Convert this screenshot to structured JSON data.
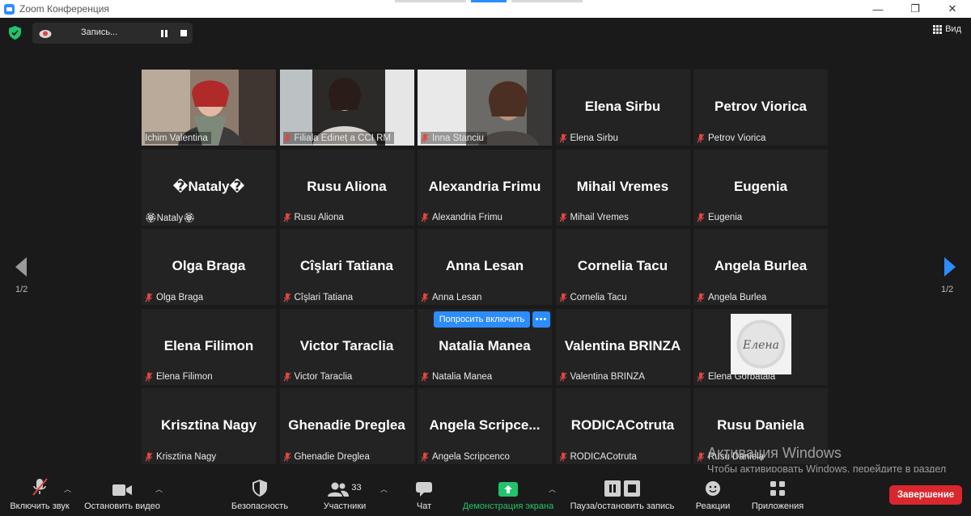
{
  "window": {
    "title": "Zoom Конференция",
    "minimize_glyph": "—",
    "maximize_glyph": "❐",
    "close_glyph": "✕"
  },
  "topbar": {
    "recording_label": "Запись...",
    "view_label": "Вид",
    "security_color": "#21c36b"
  },
  "gallery": {
    "page_indicator_left": "1/2",
    "page_indicator_right": "1/2",
    "ask_to_unmute_label": "Попросить включить",
    "more_label": "•••",
    "avatar_text": "Елена",
    "tiles": [
      {
        "name": "Ichim Valentina",
        "big": "",
        "muted": false,
        "type": "video",
        "active": true
      },
      {
        "name": "Filiala Edineț a CCI RM",
        "big": "",
        "muted": true,
        "type": "video"
      },
      {
        "name": "Inna Stanciu",
        "big": "",
        "muted": true,
        "type": "video"
      },
      {
        "name": "Elena Sirbu",
        "big": "Elena Sirbu",
        "muted": true
      },
      {
        "name": "Petrov Viorica",
        "big": "Petrov Viorica",
        "muted": true
      },
      {
        "name": "🏵Nataly🏵",
        "big": "�Nataly�",
        "muted": false
      },
      {
        "name": "Rusu Aliona",
        "big": "Rusu Aliona",
        "muted": true
      },
      {
        "name": "Alexandria Frimu",
        "big": "Alexandria Frimu",
        "muted": true
      },
      {
        "name": "Mihail Vremes",
        "big": "Mihail Vremes",
        "muted": true
      },
      {
        "name": "Eugenia",
        "big": "Eugenia",
        "muted": true
      },
      {
        "name": "Olga Braga",
        "big": "Olga Braga",
        "muted": true
      },
      {
        "name": "Cîşlari Tatiana",
        "big": "Cîşlari Tatiana",
        "muted": true
      },
      {
        "name": "Anna Lesan",
        "big": "Anna Lesan",
        "muted": true
      },
      {
        "name": "Cornelia Tacu",
        "big": "Cornelia Tacu",
        "muted": true
      },
      {
        "name": "Angela Burlea",
        "big": "Angela Burlea",
        "muted": true
      },
      {
        "name": "Elena Filimon",
        "big": "Elena Filimon",
        "muted": true
      },
      {
        "name": "Victor Taraclia",
        "big": "Victor Taraclia",
        "muted": true
      },
      {
        "name": "Natalia Manea",
        "big": "Natalia Manea",
        "muted": true
      },
      {
        "name": "Valentina BRINZA",
        "big": "Valentina BRINZA",
        "muted": true
      },
      {
        "name": "Elena Gorbataia",
        "big": "",
        "muted": true,
        "type": "avatar"
      },
      {
        "name": "Krisztina Nagy",
        "big": "Krisztina Nagy",
        "muted": true
      },
      {
        "name": "Ghenadie Dreglea",
        "big": "Ghenadie Dreglea",
        "muted": true
      },
      {
        "name": "Angela Scripcenco",
        "big": "Angela  Scripce...",
        "muted": true
      },
      {
        "name": "RODICACotruta",
        "big": "RODICACotruta",
        "muted": true
      },
      {
        "name": "Rusu Daniela",
        "big": "Rusu Daniela",
        "muted": true
      }
    ]
  },
  "watermark": {
    "title": "Активация Windows",
    "subtitle": "Чтобы активировать Windows, перейдите в раздел \"Параметры\"."
  },
  "toolbar": {
    "audio_label": "Включить звук",
    "video_label": "Остановить видео",
    "security_label": "Безопасность",
    "participants_label": "Участники",
    "participants_count": "33",
    "chat_label": "Чат",
    "share_label": "Демонстрация экрана",
    "record_label": "Пауза/остановить запись",
    "reactions_label": "Реакции",
    "apps_label": "Приложения",
    "end_label": "Завершение",
    "share_color": "#21c36b",
    "end_color": "#d9272d"
  }
}
